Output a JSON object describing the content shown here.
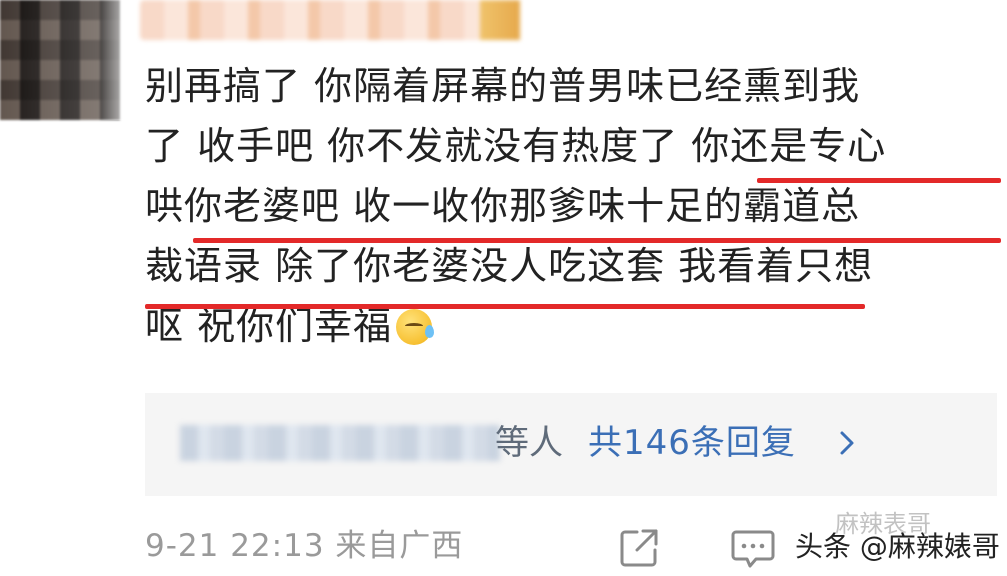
{
  "comment": {
    "lines": [
      "别再搞了 你隔着屏幕的普男味已经熏到我",
      "了 收手吧 你不发就没有热度了 你还是专心",
      "哄你老婆吧 收一收你那爹味十足的霸道总",
      "裁语录 除了你老婆没人吃这套 我看着只想",
      "呕 祝你们幸福"
    ],
    "emoji": "sweat-smile-emoji",
    "highlight_color": "#e32929"
  },
  "replies": {
    "suffix": "等人",
    "count_label": "共146条回复",
    "chevron": "chevron-right-icon"
  },
  "footer": {
    "time_location": "9-21 22:13 来自广西",
    "share_icon": "share-icon",
    "comment_icon": "comment-icon"
  },
  "watermark": {
    "text": "头条 @麻辣婊哥",
    "faint_text": "麻辣表哥"
  }
}
